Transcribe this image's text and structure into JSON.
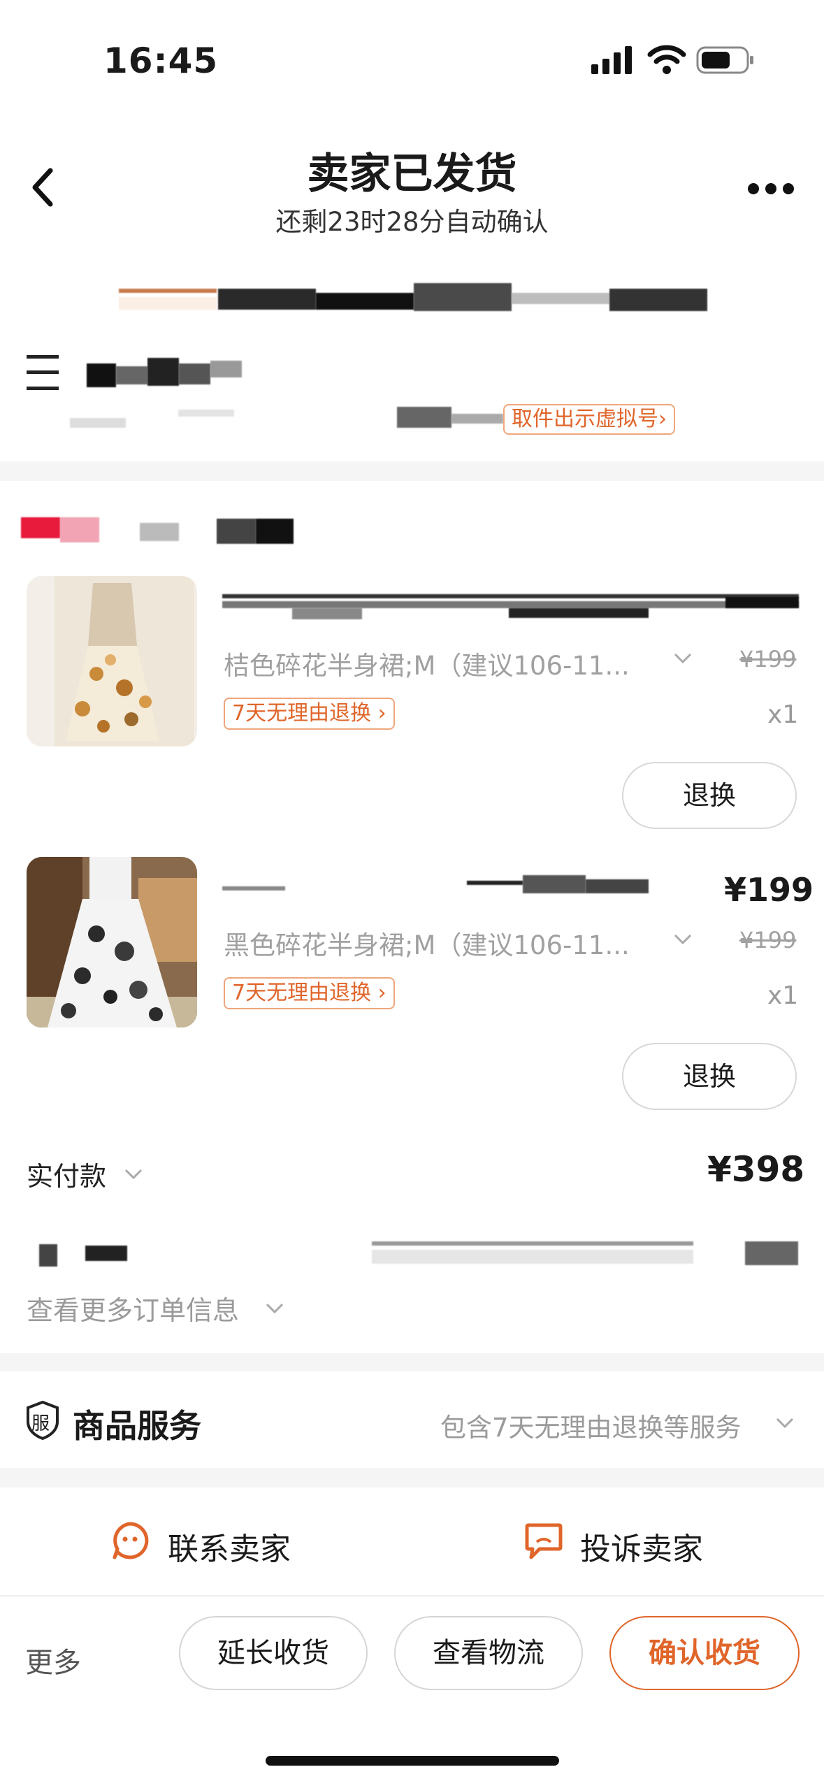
{
  "status_bar": {
    "time": "16:45"
  },
  "header": {
    "title": "卖家已发货",
    "subtitle": "还剩23时28分自动确认"
  },
  "pickup": {
    "label": "取件出示虚拟号",
    "chevron": "›"
  },
  "items": [
    {
      "spec": "桔色碎花半身裙;M（建议106-11...",
      "original_price": "¥199",
      "return_badge": "7天无理由退换",
      "qty": "x1",
      "action": "退换"
    },
    {
      "price": "¥199",
      "spec": "黑色碎花半身裙;M（建议106-11...",
      "original_price": "¥199",
      "return_badge": "7天无理由退换",
      "qty": "x1",
      "action": "退换"
    }
  ],
  "payment": {
    "label": "实付款",
    "amount": "¥398"
  },
  "order_info": {
    "more_label": "查看更多订单信息"
  },
  "service": {
    "icon_text": "服",
    "title": "商品服务",
    "desc": "包含7天无理由退换等服务"
  },
  "contact": {
    "contact_seller": "联系卖家",
    "complain_seller": "投诉卖家"
  },
  "bottom_bar": {
    "more": "更多",
    "extend": "延长收货",
    "logistics": "查看物流",
    "confirm": "确认收货"
  },
  "colors": {
    "accent": "#e0652a",
    "accent_border": "#f0a67c",
    "divider": "#f5f5f5",
    "muted": "#a0a0a0"
  }
}
